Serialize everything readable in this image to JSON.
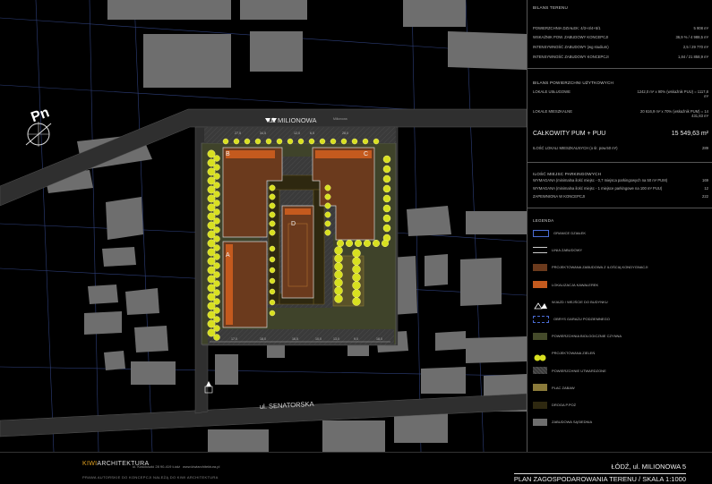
{
  "map": {
    "streets": {
      "north": "ul. MILIONOWA",
      "south": "ul. SENATORSKA",
      "north_small": "Milionowa"
    },
    "north_arrow": "Pn",
    "buildings": {
      "a": "A",
      "b": "B",
      "c": "C",
      "d": "D"
    },
    "dims_bottom": [
      "17,0",
      "18,0",
      "16,5",
      "10,0",
      "13,0",
      "9,0",
      "18,0"
    ],
    "dims_top": [
      "27,5",
      "34,5",
      "12,0",
      "6,5",
      "28,0"
    ]
  },
  "colors": {
    "background": "#000000",
    "neighbor_buildings": "#6e6e6e",
    "roads": "#333333",
    "buildings": "#6b3a1d",
    "greenery": "#d8e020",
    "terrace": "#c45a1e",
    "bio_surface": "#444a2a"
  },
  "panel": {
    "bilans_terenu": {
      "title": "BILANS TERENU",
      "rows": [
        {
          "label": "POWIERZCHNIA DZIAŁEK: 4/3+4/4+5/1",
          "value": "5 908 m²"
        },
        {
          "label": "WSKAŹNIK POW. ZABUDOWY KONCEPCJI",
          "value": "36,9 % / 4 988,5 m²"
        },
        {
          "label": "INTENSYWNOŚĆ ZABUDOWY (wg studium)",
          "value": "2,5 / 29 770 m²"
        },
        {
          "label": "INTENSYWNOŚĆ ZABUDOWY KONCEPCJI",
          "value": "1,84 / 21 858,9 m²"
        }
      ]
    },
    "bilans_pum": {
      "title": "BILANS POWIERZCHNI UŻYTKOWYCH",
      "rows": [
        {
          "label": "LOKALE USŁUGOWE",
          "value": "1242,0 m² x 90% (wskaźnik PUU) = 1117,8 m²"
        },
        {
          "label": "LOKALE MIESZKALNE",
          "value": "20 616,9 m² x 70% (wskaźnik PUM) = 14 431,83 m²"
        }
      ],
      "total_label": "CAŁKOWITY PUM + PUU",
      "total_value": "15 549,63 m²",
      "count_label": "ILOŚĆ LOKALI MIESZKALNYCH (o śr. pow.50 m²)",
      "count_value": "289"
    },
    "parking": {
      "title": "ILOŚĆ MIEJSC PARKINGOWYCH",
      "rows": [
        {
          "label": "WYMAGANA (minimalna ilość miejsc - 0,7 miejsca parkingowych na 50 m² PUM)",
          "value": "169"
        },
        {
          "label": "WYMAGANA (minimalna ilość miejsc - 1 miejsce parkingowe na 100 m² PUU)",
          "value": "12"
        },
        {
          "label": "ZAPEWNIONA W KONCEPCJI",
          "value": "222"
        }
      ]
    },
    "legend": {
      "title": "LEGENDA",
      "items": [
        {
          "label": "GRANICE DZIAŁEK",
          "swatch": "boundary",
          "color": "#4a6cd4"
        },
        {
          "label": "LINIA ZABUDOWY",
          "swatch": "line",
          "color": "#cccccc"
        },
        {
          "label": "PROJEKTOWANA ZABUDOWA Z ILOŚCIĄ KONDYGNACJI",
          "swatch": "fill",
          "color": "#6b3a1d"
        },
        {
          "label": "LOKALIZACJA KAWALEREK",
          "swatch": "fill",
          "color": "#c45a1e"
        },
        {
          "label": "WJAZD / WEJŚCIE DO BUDYNKU",
          "swatch": "entry",
          "color": "#ffffff"
        },
        {
          "label": "OBRYS GARAŻU PODZIEMNEGO",
          "swatch": "dashed",
          "color": "#4a6cd4"
        },
        {
          "label": "POWIERZCHNIA BIOLOGICZNIE CZYNNA",
          "swatch": "fill",
          "color": "#444a2a"
        },
        {
          "label": "PROJEKTOWANA ZIELEŃ",
          "swatch": "tree",
          "color": "#d8e020"
        },
        {
          "label": "POWIERZCHNIE UTWARDZONE",
          "swatch": "hatch",
          "color": "#444444"
        },
        {
          "label": "PLAC ZABAW",
          "swatch": "fill",
          "color": "#8a7a3a"
        },
        {
          "label": "DROGA P.POŻ",
          "swatch": "fill",
          "color": "#2e2810"
        },
        {
          "label": "ZABUDOWA SĄSIEDNIA",
          "swatch": "fill",
          "color": "#6e6e6e"
        }
      ]
    }
  },
  "footer": {
    "brand_a": "KIWI",
    "brand_b": "ARCHITEKTURA",
    "address": "ul. Kościuszki 28 90-419 Łódź",
    "website": "www.kiwiarchitektura.pl",
    "subtitle": "PRAWA AUTORSKIE DO KONCEPCJI NALEŻĄ DO KIWI ARCHITEKTURA",
    "location": "ŁÓDŹ, ul. MILIONOWA 5",
    "title": "PLAN ZAGOSPODAROWANIA TERENU / SKALA 1:1000"
  }
}
